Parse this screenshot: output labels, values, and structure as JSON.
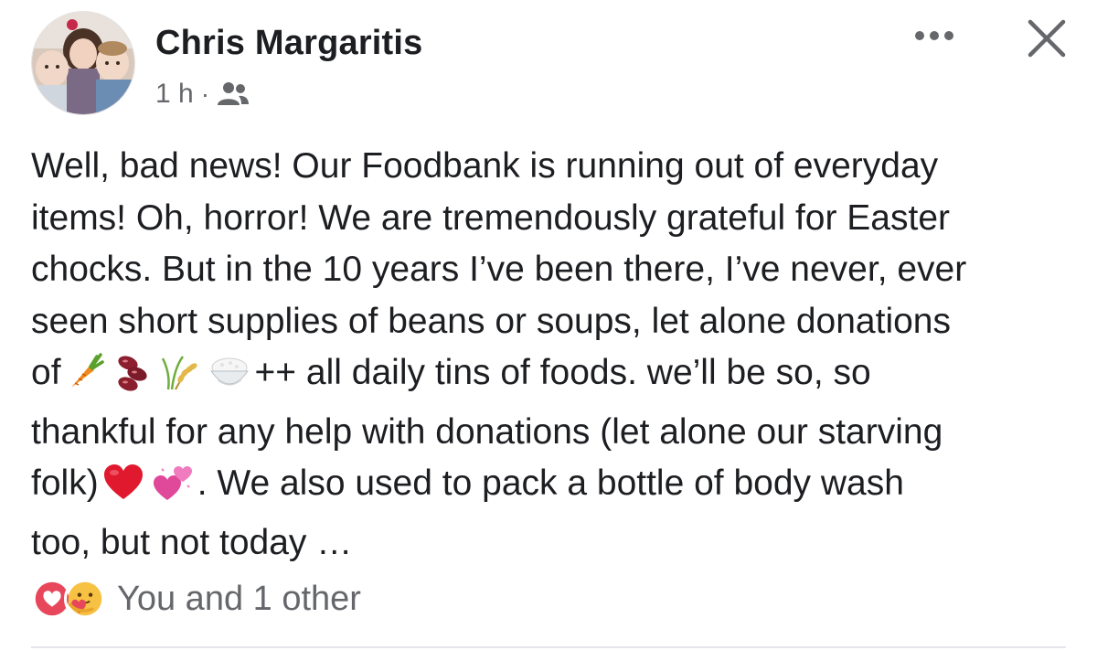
{
  "post": {
    "author": "Chris Margaritis",
    "time": "1 h",
    "separator": "·",
    "audience_icon": "friends-icon",
    "lines": {
      "l1": "Well, bad news! Our Foodbank is running out of everyday",
      "l2": "items! Oh, horror! We are tremendously grateful for Easter",
      "l3": "chocks. But in the 10 years I’ve been there, I’ve never, ever",
      "l4": "seen short supplies of beans or soups, let alone donations",
      "l5_start": "of",
      "l5_end": "++ all daily tins of foods. we’ll be so, so",
      "l6": "thankful for any help with donations (let alone our starving",
      "l7_start": "folk)",
      "l7_end": ". We also used to pack a bottle of body wash",
      "l8": "too, but not today …"
    },
    "emojis": [
      "carrot-emoji",
      "beans-emoji",
      "rice-sheaf-emoji",
      "rice-bowl-emoji",
      "red-heart-emoji",
      "two-hearts-emoji"
    ]
  },
  "reactions": {
    "icons": [
      "love-reaction-icon",
      "care-reaction-icon"
    ],
    "summary": "You and 1 other"
  },
  "colors": {
    "text": "#1c1e21",
    "secondary": "#65676b",
    "love": "#e8465b",
    "care": "#f7c143"
  }
}
